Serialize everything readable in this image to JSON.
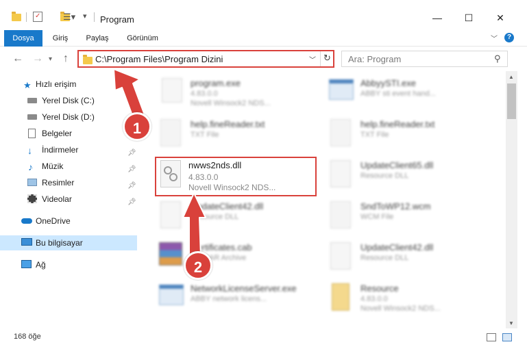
{
  "window": {
    "title": "Program",
    "minimize": "—",
    "maximize": "☐",
    "close": "✕"
  },
  "ribbon": {
    "tabs": [
      "Dosya",
      "Giriş",
      "Paylaş",
      "Görünüm"
    ],
    "active_tab": "Dosya",
    "help": "?"
  },
  "address": {
    "path": "C:\\Program Files\\Program Dizini"
  },
  "search": {
    "placeholder": "Ara: Program"
  },
  "sidebar": {
    "items": [
      {
        "label": "Hızlı erişim",
        "icon": "star-icon"
      },
      {
        "label": "Yerel Disk (C:)",
        "icon": "drive-icon"
      },
      {
        "label": "Yerel Disk (D:)",
        "icon": "drive-icon"
      },
      {
        "label": "Belgeler",
        "icon": "documents-icon"
      },
      {
        "label": "İndirmeler",
        "icon": "download-icon"
      },
      {
        "label": "Müzik",
        "icon": "music-icon"
      },
      {
        "label": "Resimler",
        "icon": "pictures-icon"
      },
      {
        "label": "Videolar",
        "icon": "videos-icon"
      },
      {
        "label": "OneDrive",
        "icon": "cloud-icon"
      },
      {
        "label": "Bu bilgisayar",
        "icon": "computer-icon"
      },
      {
        "label": "Ağ",
        "icon": "network-icon"
      }
    ],
    "selected": "Bu bilgisayar"
  },
  "files": [
    {
      "name": "program.exe",
      "line2": "4.83.0.0",
      "line3": "Novell Winsock2 NDS..."
    },
    {
      "name": "AbbyySTI.exe",
      "line2": "ABBY sti event hand...",
      "line3": ""
    },
    {
      "name": "help.fineReader.txt",
      "line2": "TXT File",
      "line3": ""
    },
    {
      "name": "help.fineReader.txt",
      "line2": "TXT File",
      "line3": ""
    },
    {
      "name": "nwws2nds.dll",
      "line2": "4.83.0.0",
      "line3": "Novell Winsock2 NDS..."
    },
    {
      "name": "UpdateClient65.dll",
      "line2": "Resource DLL",
      "line3": ""
    },
    {
      "name": "UpdateClient42.dll",
      "line2": "Resource DLL",
      "line3": ""
    },
    {
      "name": "SndToWP12.wcm",
      "line2": "WCM File",
      "line3": ""
    },
    {
      "name": "Certificates.cab",
      "line2": "WinRAR Archive",
      "line3": ""
    },
    {
      "name": "UpdateClient42.dll",
      "line2": "Resource DLL",
      "line3": ""
    },
    {
      "name": "NetworkLicenseServer.exe",
      "line2": "ABBY network licens...",
      "line3": ""
    },
    {
      "name": "Resource",
      "line2": "4.83.0.0",
      "line3": "Novell Winsock2 NDS..."
    }
  ],
  "status": {
    "count": "168 öğe"
  },
  "annotations": {
    "step1": "1",
    "step2": "2",
    "color": "#d9413b"
  },
  "colors": {
    "accent": "#1979ca",
    "selected_bg": "#cce8ff"
  }
}
